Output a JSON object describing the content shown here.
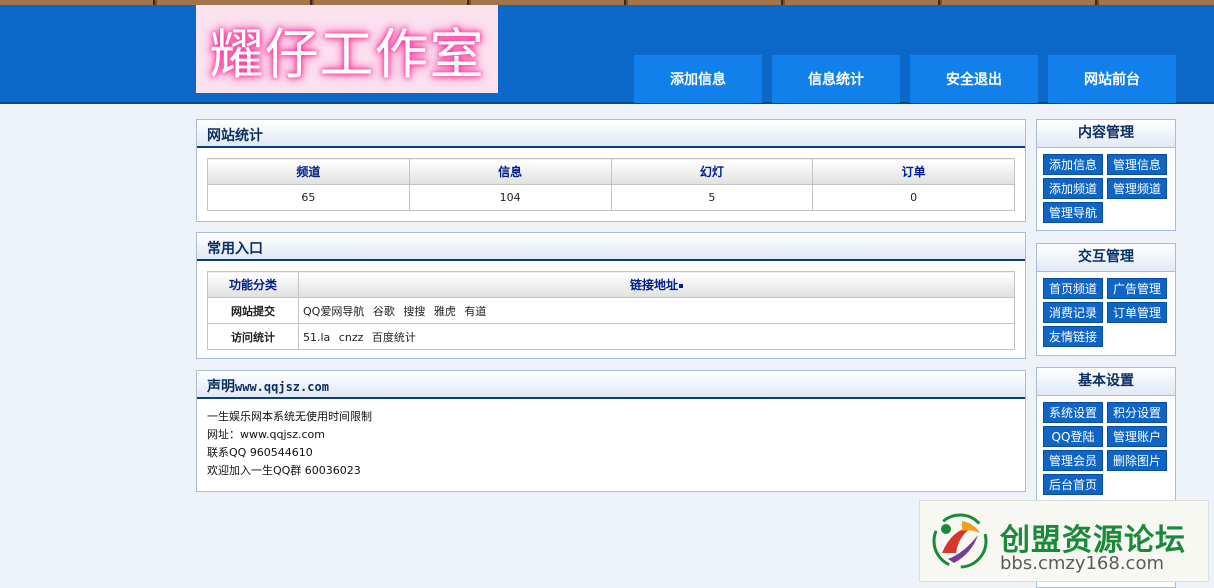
{
  "header": {
    "logo_text": "耀仔工作室",
    "nav": [
      "添加信息",
      "信息统计",
      "安全退出",
      "网站前台"
    ]
  },
  "stats": {
    "title": "网站统计",
    "columns": [
      "频道",
      "信息",
      "幻灯",
      "订单"
    ],
    "values": [
      "65",
      "104",
      "5",
      "0"
    ]
  },
  "entry": {
    "title": "常用入口",
    "col_category": "功能分类",
    "col_link": "链接地址",
    "rows": [
      {
        "label": "网站提交",
        "links": [
          "QQ爱网导航",
          "谷歌",
          "搜搜",
          "雅虎",
          "有道"
        ]
      },
      {
        "label": "访问统计",
        "links": [
          "51.la",
          "cnzz",
          "百度统计"
        ]
      }
    ]
  },
  "notice": {
    "title": "声明",
    "title_site": "www.qqjsz.com",
    "lines": [
      "一生娱乐网本系统无使用时间限制",
      "网址：www.qqjsz.com",
      "联系QQ 960544610",
      "欢迎加入一生QQ群 60036023"
    ]
  },
  "sidebar": [
    {
      "title": "内容管理",
      "buttons": [
        "添加信息",
        "管理信息",
        "添加频道",
        "管理频道",
        "管理导航"
      ]
    },
    {
      "title": "交互管理",
      "buttons": [
        "首页频道",
        "广告管理",
        "消费记录",
        "订单管理",
        "友情链接"
      ]
    },
    {
      "title": "基本设置",
      "buttons": [
        "系统设置",
        "积分设置",
        "QQ登陆",
        "管理账户",
        "管理会员",
        "删除图片",
        "后台首页"
      ]
    }
  ],
  "watermark": {
    "title": "创盟资源论坛",
    "url": "bbs.cmzy168.com"
  },
  "colors": {
    "header_bg": "#0b67c8",
    "nav_button": "#1280ea",
    "side_button": "#0f65c6",
    "title_text": "#0c2f63"
  }
}
